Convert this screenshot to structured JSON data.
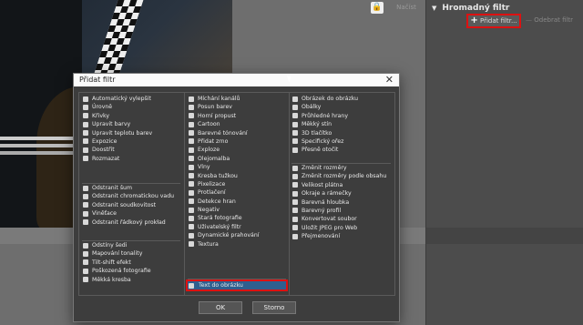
{
  "topbar": {
    "lock_icon": "lock-icon",
    "next_label": "Načíst"
  },
  "panel": {
    "header": "Hromadný filtr",
    "add_label": "Přidat filtr...",
    "remove_label": "Odebrat filtr"
  },
  "dialog": {
    "title": "Přidat filtr",
    "ok_label": "OK",
    "cancel_label": "Storno",
    "col1": [
      [
        "Automatický vylepšit",
        "Úrovně",
        "Křivky",
        "Upravit barvy",
        "Upravit teplotu barev",
        "Expozice",
        "Doostřit",
        "Rozmazat"
      ],
      [
        "Odstranit šum",
        "Odstranit chromatickou vadu",
        "Odstranit soudkovitost",
        "Viněťace",
        "Odstranit řádkový prokład"
      ],
      [
        "Odstíny šedi",
        "Mapování tonality",
        "Tilt-shift efekt",
        "Poškozená fotografie",
        "Měkká kresba"
      ]
    ],
    "col2": [
      [
        "Míchání kanálů",
        "Posun barev",
        "Horní propust",
        "Cartoon",
        "Barevné tónování",
        "Přidat zrno",
        "Exploze",
        "Olejomalba",
        "Vlny",
        "Kresba tužkou",
        "Pixelizace",
        "Protlačení",
        "Detekce hran",
        "Negativ",
        "Stará fotografie",
        "Uživatelský filtr",
        "Dynamické prahování",
        "Textura"
      ],
      [
        "Text do obrázku"
      ]
    ],
    "col3": [
      [
        "Obrázek do obrázku",
        "Obálky",
        "Průhledné hrany",
        "Měkký stín",
        "3D tlačítko",
        "Specifický ořez",
        "Přesně otočit"
      ],
      [
        "Změnit rozměry",
        "Změnit rozměry podle obsahu",
        "Velikost plátna",
        "Okraje a rámečky",
        "Barevná hloubka",
        "Barevný profil",
        "Konvertovat soubor",
        "Uložit JPEG pro Web",
        "Přejmenování"
      ]
    ]
  }
}
